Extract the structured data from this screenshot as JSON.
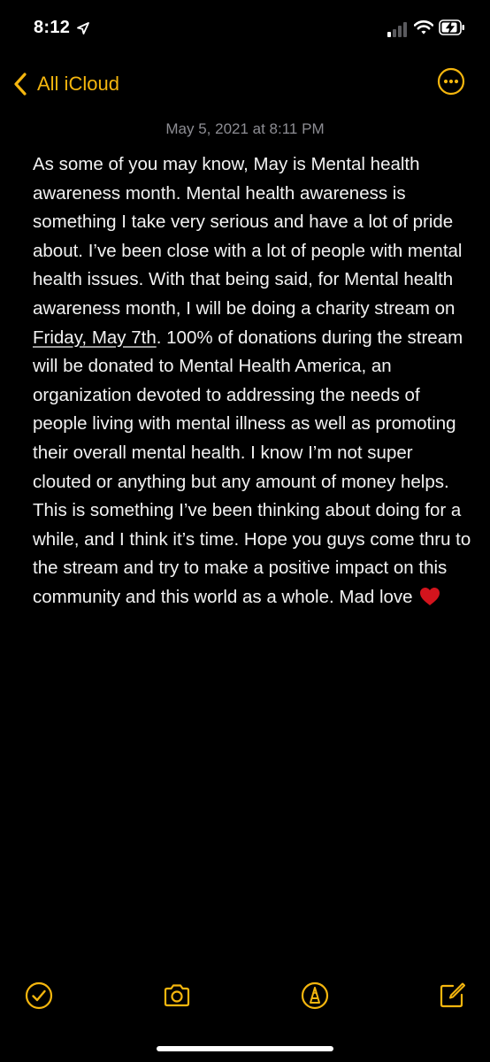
{
  "status_bar": {
    "time": "8:12",
    "icons": [
      "location-arrow-icon",
      "cellular-signal-icon",
      "wifi-icon",
      "battery-charging-icon"
    ]
  },
  "nav": {
    "back_label": "All iCloud",
    "back_icon": "chevron-left-icon",
    "more_icon": "ellipsis-circle-icon"
  },
  "note": {
    "date": "May 5, 2021 at 8:11 PM",
    "body_before_link": "As some of you may know, May is Mental health awareness month. Mental health awareness is something I take very serious and have a lot of pride about. I’ve been close with a lot of people with mental health issues. With that being said, for Mental health awareness month, I will be doing a charity stream on ",
    "date_link": "Friday, May 7th",
    "body_after_link": ". 100% of donations during the stream will be donated to Mental Health America, an organization devoted to addressing the needs of people living with mental illness as well as promoting their overall mental health. I know I’m not super clouted or anything but any amount of money helps. This is something I’ve been thinking about doing for a while, and I think it’s time. Hope you guys come thru to the stream and try to make a positive impact on this community and this world as a whole. Mad love ",
    "emoji": "red-heart-icon"
  },
  "toolbar": {
    "items": [
      "checklist-icon",
      "camera-icon",
      "markup-icon",
      "compose-icon"
    ]
  },
  "colors": {
    "accent": "#f5b60e",
    "background": "#000000",
    "text": "#f2f2f2",
    "secondary_text": "#8d8d93",
    "heart": "#d3141d"
  }
}
